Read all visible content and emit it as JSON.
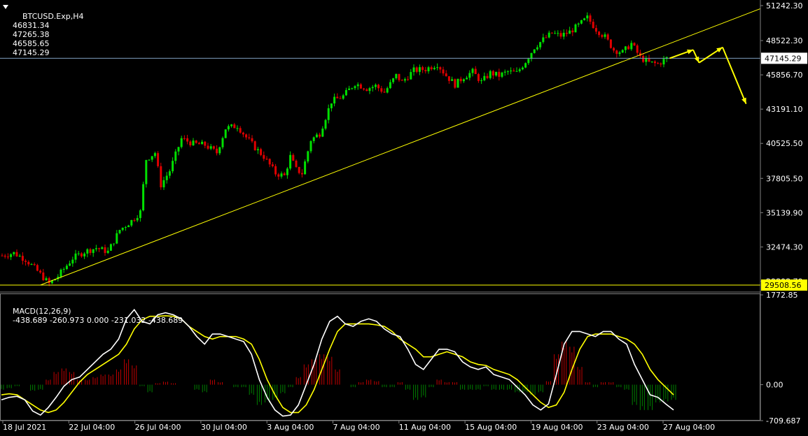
{
  "header": {
    "symbol": "BTCUSD.Exp,H4",
    "open": "46831.34",
    "high": "47265.38",
    "low": "46585.65",
    "close": "47145.29"
  },
  "macd_header": {
    "label": "MACD(12,26,9)",
    "values": "-438.689 -260.973 0.000 -231.032 -438.689"
  },
  "colors": {
    "background": "#000000",
    "bull": "#00e000",
    "bear": "#e00000",
    "trendline": "#ffff00",
    "hline": "#7f9fbf",
    "axis_text": "#ffffff",
    "macd_line": "#ffffff",
    "signal_line": "#ffff00",
    "arrow": "#ffff00"
  },
  "chart_data": [
    {
      "type": "candlestick",
      "title": "BTCUSD.Exp,H4",
      "ylim": [
        29508.56,
        51242.3
      ],
      "y_ticks": [
        "51242.30",
        "48522.30",
        "45856.70",
        "43191.10",
        "40525.50",
        "37805.50",
        "35139.90",
        "32474.30",
        "29808.70"
      ],
      "x_ticks": [
        "18 Jul 2021",
        "22 Jul 04:00",
        "26 Jul 04:00",
        "30 Jul 04:00",
        "3 Aug 04:00",
        "7 Aug 04:00",
        "11 Aug 04:00",
        "15 Aug 04:00",
        "19 Aug 04:00",
        "23 Aug 04:00",
        "27 Aug 04:00"
      ],
      "current_price_label": "47145.29",
      "low_price_label": "29508.56",
      "close_path": [
        [
          0,
          31800
        ],
        [
          4,
          32000
        ],
        [
          8,
          31500
        ],
        [
          12,
          30600
        ],
        [
          16,
          29600
        ],
        [
          19,
          30200
        ],
        [
          24,
          31600
        ],
        [
          28,
          32100
        ],
        [
          32,
          32400
        ],
        [
          36,
          32100
        ],
        [
          40,
          33800
        ],
        [
          44,
          34500
        ],
        [
          47,
          35200
        ],
        [
          49,
          39300
        ],
        [
          52,
          39800
        ],
        [
          54,
          37300
        ],
        [
          57,
          38400
        ],
        [
          61,
          40900
        ],
        [
          65,
          40500
        ],
        [
          69,
          40400
        ],
        [
          73,
          39800
        ],
        [
          76,
          41700
        ],
        [
          80,
          41900
        ],
        [
          83,
          41000
        ],
        [
          86,
          40200
        ],
        [
          89,
          39500
        ],
        [
          93,
          38200
        ],
        [
          96,
          38000
        ],
        [
          98,
          39500
        ],
        [
          100,
          38500
        ],
        [
          102,
          38200
        ],
        [
          105,
          40800
        ],
        [
          108,
          41300
        ],
        [
          112,
          43800
        ],
        [
          116,
          44200
        ],
        [
          120,
          45200
        ],
        [
          124,
          44800
        ],
        [
          127,
          45000
        ],
        [
          130,
          44500
        ],
        [
          134,
          45800
        ],
        [
          136,
          45300
        ],
        [
          140,
          46200
        ],
        [
          144,
          46300
        ],
        [
          148,
          46700
        ],
        [
          151,
          45800
        ],
        [
          154,
          45100
        ],
        [
          157,
          45700
        ],
        [
          160,
          46100
        ],
        [
          163,
          45300
        ],
        [
          166,
          46000
        ],
        [
          169,
          45800
        ],
        [
          172,
          46100
        ],
        [
          175,
          46000
        ],
        [
          178,
          46900
        ],
        [
          181,
          48000
        ],
        [
          184,
          48600
        ],
        [
          187,
          49100
        ],
        [
          190,
          48900
        ],
        [
          193,
          49200
        ],
        [
          196,
          49700
        ],
        [
          199,
          50300
        ],
        [
          202,
          49400
        ],
        [
          205,
          48800
        ],
        [
          208,
          47800
        ],
        [
          211,
          47600
        ],
        [
          214,
          48300
        ],
        [
          217,
          47200
        ],
        [
          220,
          46800
        ],
        [
          223,
          46700
        ],
        [
          226,
          47145
        ]
      ],
      "trendline": {
        "from": {
          "x": "18 Jul 2021",
          "y": 29508.56
        },
        "to": {
          "x": "after 27 Aug 04:00",
          "y": 51000
        }
      },
      "horizontal_lines": [
        47145.29,
        29508.56
      ],
      "projection_arrows": [
        [
          47145,
          47800
        ],
        [
          47800,
          46800
        ],
        [
          46800,
          48000
        ],
        [
          48000,
          43600
        ]
      ]
    },
    {
      "type": "macd",
      "title": "MACD(12,26,9)",
      "ylim": [
        -709.687,
        1772.85
      ],
      "y_ticks": [
        "1772.85",
        "0.00",
        "-709.687"
      ],
      "macd": [
        -300,
        -250,
        -230,
        -300,
        -520,
        -600,
        -450,
        -250,
        -30,
        100,
        150,
        300,
        450,
        600,
        700,
        900,
        1300,
        1480,
        1250,
        1200,
        1380,
        1420,
        1380,
        1300,
        1150,
        950,
        800,
        1000,
        1000,
        950,
        900,
        850,
        600,
        100,
        -250,
        -500,
        -620,
        -600,
        -400,
        0,
        400,
        900,
        1250,
        1350,
        1200,
        1150,
        1250,
        1300,
        1250,
        1100,
        1000,
        950,
        700,
        400,
        300,
        500,
        700,
        700,
        650,
        450,
        350,
        300,
        350,
        200,
        150,
        100,
        -50,
        -200,
        -400,
        -500,
        -380,
        200,
        800,
        1050,
        1050,
        1000,
        950,
        1050,
        1050,
        900,
        800,
        400,
        100,
        -200,
        -250,
        -380,
        -500
      ],
      "signal": [
        -200,
        -180,
        -200,
        -300,
        -400,
        -500,
        -550,
        -500,
        -350,
        -150,
        50,
        200,
        300,
        400,
        500,
        600,
        800,
        1100,
        1280,
        1350,
        1350,
        1360,
        1350,
        1300,
        1150,
        1050,
        950,
        900,
        950,
        950,
        950,
        900,
        800,
        500,
        100,
        -200,
        -450,
        -550,
        -550,
        -400,
        -100,
        300,
        700,
        1050,
        1200,
        1200,
        1200,
        1200,
        1180,
        1150,
        1050,
        900,
        800,
        700,
        550,
        550,
        600,
        650,
        600,
        550,
        450,
        400,
        380,
        300,
        250,
        200,
        100,
        -50,
        -200,
        -350,
        -450,
        -400,
        -150,
        300,
        700,
        950,
        1000,
        1000,
        1000,
        950,
        900,
        800,
        600,
        300,
        100,
        -50,
        -200
      ],
      "histogram": [
        -100,
        -70,
        -30,
        0,
        -120,
        -100,
        100,
        250,
        320,
        250,
        100,
        100,
        150,
        200,
        200,
        300,
        500,
        380,
        -30,
        -150,
        30,
        60,
        30,
        0,
        0,
        -100,
        -150,
        100,
        50,
        0,
        -50,
        -50,
        -200,
        -400,
        -350,
        -300,
        -170,
        -50,
        150,
        400,
        500,
        600,
        550,
        300,
        0,
        -50,
        50,
        100,
        70,
        -50,
        -50,
        50,
        -100,
        -300,
        -250,
        -50,
        100,
        50,
        50,
        -100,
        -100,
        -100,
        -30,
        -100,
        -100,
        -100,
        -150,
        -150,
        -200,
        -150,
        70,
        600,
        850,
        750,
        350,
        50,
        -50,
        50,
        50,
        -50,
        -100,
        -400,
        -500,
        -500,
        -350,
        -330,
        -300
      ]
    }
  ]
}
